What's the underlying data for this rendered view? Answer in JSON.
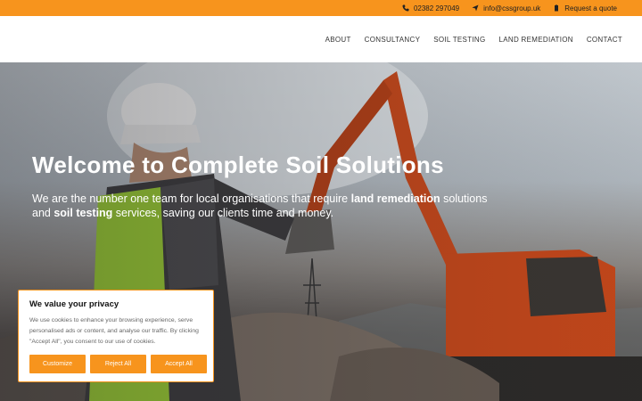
{
  "topbar": {
    "phone": "02382 297049",
    "email": "info@cssgroup.uk",
    "quote": "Request a quote"
  },
  "nav": {
    "items": [
      "ABOUT",
      "CONSULTANCY",
      "SOIL TESTING",
      "LAND REMEDIATION",
      "CONTACT"
    ]
  },
  "hero": {
    "title": "Welcome to Complete Soil Solutions",
    "text_1": "We are the number one team for local organisations that require ",
    "text_bold_1": "land remediation",
    "text_2": " solutions and ",
    "text_bold_2": "soil testing",
    "text_3": " services, saving our clients time and money."
  },
  "cookie": {
    "title": "We value your privacy",
    "text": "We use cookies to enhance your browsing experience, serve personalised ads or content, and analyse our traffic. By clicking \"Accept All\", you consent to our use of cookies.",
    "customize": "Customize",
    "reject": "Reject All",
    "accept": "Accept All"
  },
  "colors": {
    "accent": "#f7941d",
    "excavator": "#c8481a"
  }
}
